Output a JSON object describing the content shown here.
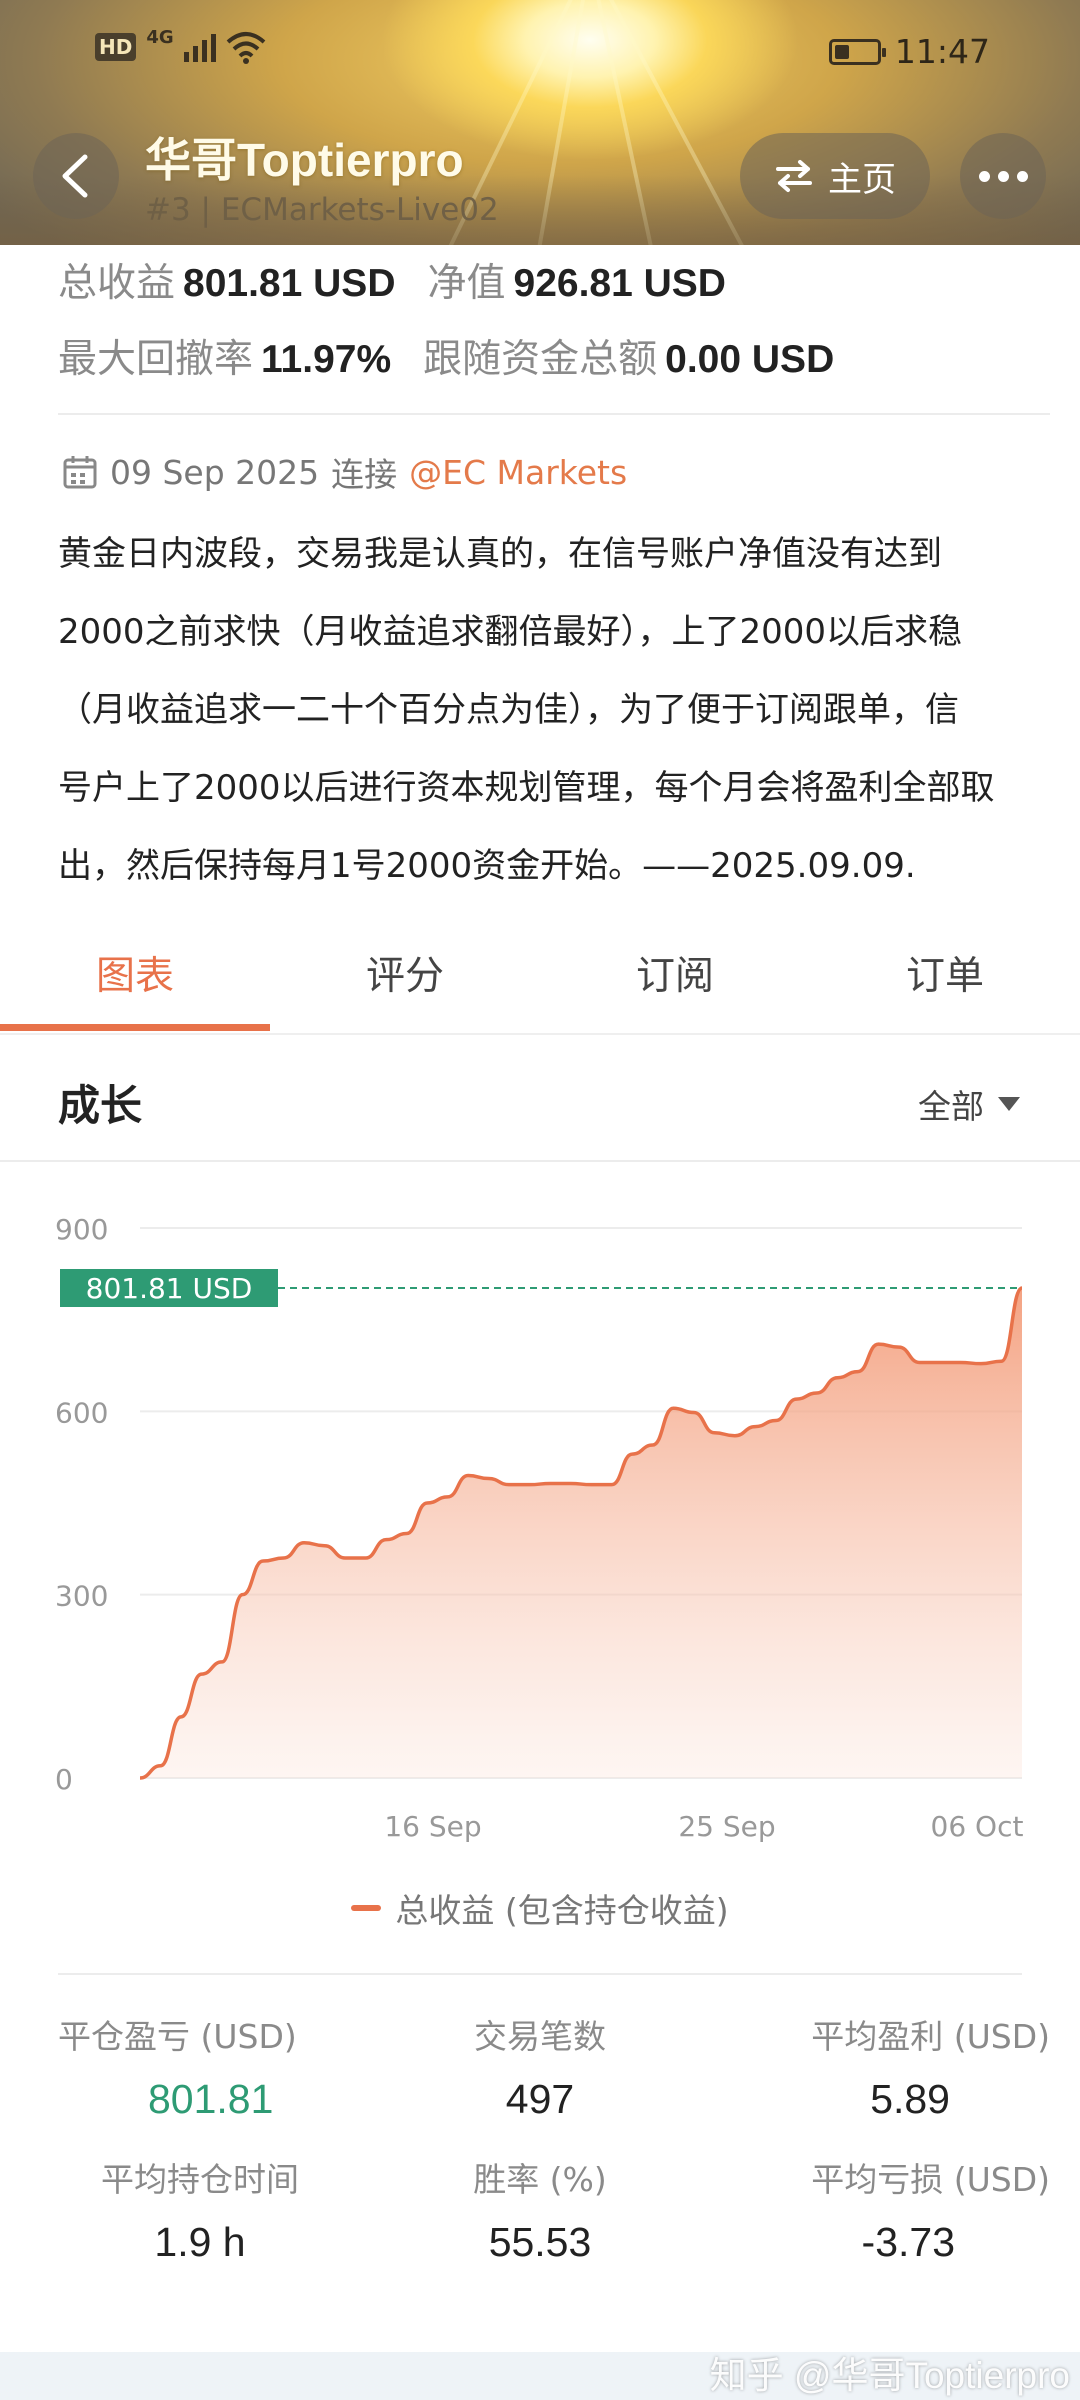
{
  "status_bar": {
    "hd": "HD",
    "network": "4G",
    "time": "11:47"
  },
  "header": {
    "trader_name": "华哥Toptierpro",
    "subtitle": "#3 | ECMarkets-Live02",
    "home_label": "主页"
  },
  "summary": {
    "total_profit_label": "总收益",
    "total_profit_value": "801.81 USD",
    "equity_label": "净值",
    "equity_value": "926.81 USD",
    "drawdown_label": "最大回撤率",
    "drawdown_value": "11.97%",
    "follow_label": "跟随资金总额",
    "follow_value": "0.00 USD"
  },
  "connection": {
    "date": "09 Sep 2025",
    "connect_word": "连接",
    "broker": "@EC Markets"
  },
  "description": {
    "lines": [
      "黄金日内波段，交易我是认真的，在信号账户净值没有达到",
      "2000之前求快（月收益追求翻倍最好），上了2000以后求稳",
      "（月收益追求一二十个百分点为佳），为了便于订阅跟单，信",
      "号户上了2000以后进行资本规划管理，每个月会将盈利全部取",
      "出，然后保持每月1号2000资金开始。——2025.09.09."
    ]
  },
  "tabs": [
    "图表",
    "评分",
    "订阅",
    "订单"
  ],
  "growth": {
    "title": "成长",
    "range": "全部"
  },
  "chart_data": {
    "type": "area",
    "y_ticks": [
      "900",
      "600",
      "300",
      "0"
    ],
    "x_ticks": [
      "16 Sep",
      "25 Sep",
      "06 Oct"
    ],
    "ylim": [
      0,
      900
    ],
    "current_label": "801.81 USD",
    "current_value": 801.81,
    "series": [
      {
        "name": "总收益 (包含持仓收益)",
        "color": "#e8724a",
        "values": [
          0,
          20,
          100,
          170,
          190,
          300,
          355,
          360,
          385,
          380,
          360,
          360,
          390,
          400,
          450,
          460,
          495,
          490,
          480,
          480,
          482,
          482,
          480,
          480,
          530,
          545,
          605,
          598,
          565,
          560,
          575,
          585,
          620,
          630,
          655,
          665,
          710,
          705,
          680,
          680,
          680,
          678,
          682,
          801.81
        ]
      }
    ]
  },
  "legend_label": "总收益 (包含持仓收益)",
  "stats": [
    {
      "label": "平仓盈亏 (USD)",
      "value": "801.81"
    },
    {
      "label": "交易笔数",
      "value": "497"
    },
    {
      "label": "平均盈利 (USD)",
      "value": "5.89"
    },
    {
      "label": "平均持仓时间",
      "value": "1.9 h"
    },
    {
      "label": "胜率 (%)",
      "value": "55.53"
    },
    {
      "label": "平均亏损 (USD)",
      "value": "-3.73"
    }
  ],
  "watermark": "知乎 @华哥Toptierpro"
}
